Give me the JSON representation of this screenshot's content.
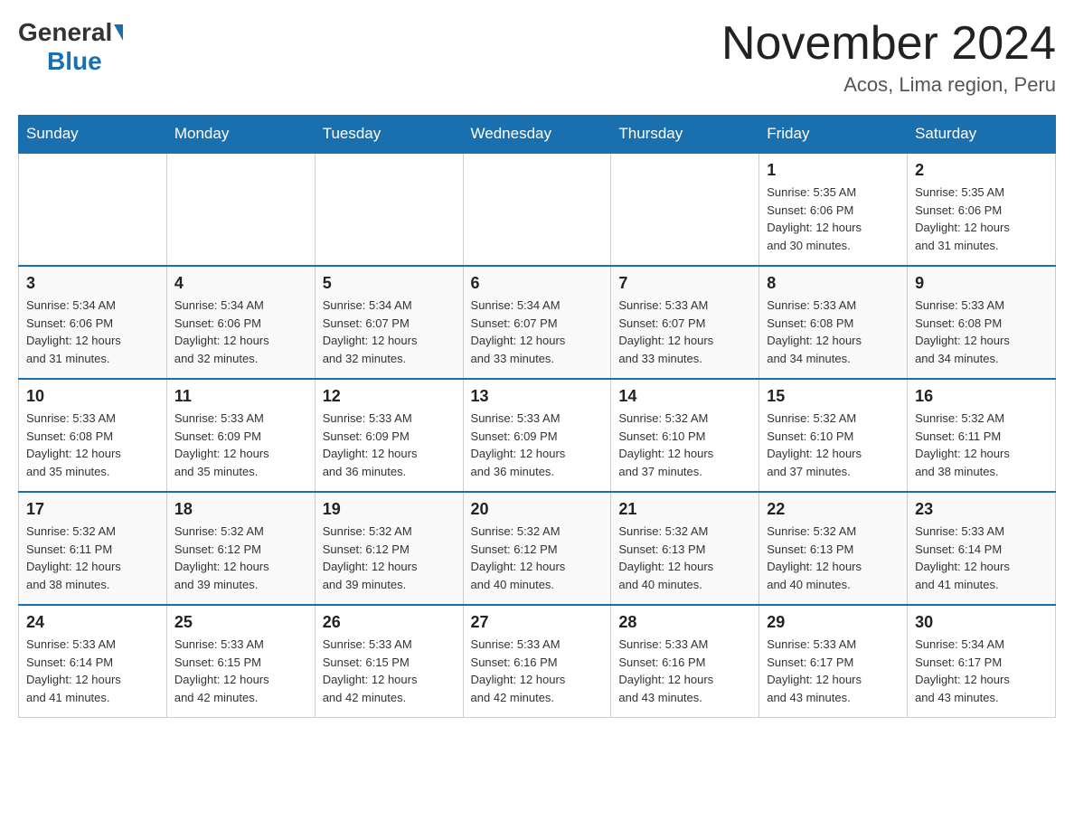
{
  "header": {
    "logo_general": "General",
    "logo_blue": "Blue",
    "month_title": "November 2024",
    "location": "Acos, Lima region, Peru"
  },
  "days_of_week": [
    "Sunday",
    "Monday",
    "Tuesday",
    "Wednesday",
    "Thursday",
    "Friday",
    "Saturday"
  ],
  "weeks": [
    [
      {
        "day": "",
        "info": ""
      },
      {
        "day": "",
        "info": ""
      },
      {
        "day": "",
        "info": ""
      },
      {
        "day": "",
        "info": ""
      },
      {
        "day": "",
        "info": ""
      },
      {
        "day": "1",
        "info": "Sunrise: 5:35 AM\nSunset: 6:06 PM\nDaylight: 12 hours\nand 30 minutes."
      },
      {
        "day": "2",
        "info": "Sunrise: 5:35 AM\nSunset: 6:06 PM\nDaylight: 12 hours\nand 31 minutes."
      }
    ],
    [
      {
        "day": "3",
        "info": "Sunrise: 5:34 AM\nSunset: 6:06 PM\nDaylight: 12 hours\nand 31 minutes."
      },
      {
        "day": "4",
        "info": "Sunrise: 5:34 AM\nSunset: 6:06 PM\nDaylight: 12 hours\nand 32 minutes."
      },
      {
        "day": "5",
        "info": "Sunrise: 5:34 AM\nSunset: 6:07 PM\nDaylight: 12 hours\nand 32 minutes."
      },
      {
        "day": "6",
        "info": "Sunrise: 5:34 AM\nSunset: 6:07 PM\nDaylight: 12 hours\nand 33 minutes."
      },
      {
        "day": "7",
        "info": "Sunrise: 5:33 AM\nSunset: 6:07 PM\nDaylight: 12 hours\nand 33 minutes."
      },
      {
        "day": "8",
        "info": "Sunrise: 5:33 AM\nSunset: 6:08 PM\nDaylight: 12 hours\nand 34 minutes."
      },
      {
        "day": "9",
        "info": "Sunrise: 5:33 AM\nSunset: 6:08 PM\nDaylight: 12 hours\nand 34 minutes."
      }
    ],
    [
      {
        "day": "10",
        "info": "Sunrise: 5:33 AM\nSunset: 6:08 PM\nDaylight: 12 hours\nand 35 minutes."
      },
      {
        "day": "11",
        "info": "Sunrise: 5:33 AM\nSunset: 6:09 PM\nDaylight: 12 hours\nand 35 minutes."
      },
      {
        "day": "12",
        "info": "Sunrise: 5:33 AM\nSunset: 6:09 PM\nDaylight: 12 hours\nand 36 minutes."
      },
      {
        "day": "13",
        "info": "Sunrise: 5:33 AM\nSunset: 6:09 PM\nDaylight: 12 hours\nand 36 minutes."
      },
      {
        "day": "14",
        "info": "Sunrise: 5:32 AM\nSunset: 6:10 PM\nDaylight: 12 hours\nand 37 minutes."
      },
      {
        "day": "15",
        "info": "Sunrise: 5:32 AM\nSunset: 6:10 PM\nDaylight: 12 hours\nand 37 minutes."
      },
      {
        "day": "16",
        "info": "Sunrise: 5:32 AM\nSunset: 6:11 PM\nDaylight: 12 hours\nand 38 minutes."
      }
    ],
    [
      {
        "day": "17",
        "info": "Sunrise: 5:32 AM\nSunset: 6:11 PM\nDaylight: 12 hours\nand 38 minutes."
      },
      {
        "day": "18",
        "info": "Sunrise: 5:32 AM\nSunset: 6:12 PM\nDaylight: 12 hours\nand 39 minutes."
      },
      {
        "day": "19",
        "info": "Sunrise: 5:32 AM\nSunset: 6:12 PM\nDaylight: 12 hours\nand 39 minutes."
      },
      {
        "day": "20",
        "info": "Sunrise: 5:32 AM\nSunset: 6:12 PM\nDaylight: 12 hours\nand 40 minutes."
      },
      {
        "day": "21",
        "info": "Sunrise: 5:32 AM\nSunset: 6:13 PM\nDaylight: 12 hours\nand 40 minutes."
      },
      {
        "day": "22",
        "info": "Sunrise: 5:32 AM\nSunset: 6:13 PM\nDaylight: 12 hours\nand 40 minutes."
      },
      {
        "day": "23",
        "info": "Sunrise: 5:33 AM\nSunset: 6:14 PM\nDaylight: 12 hours\nand 41 minutes."
      }
    ],
    [
      {
        "day": "24",
        "info": "Sunrise: 5:33 AM\nSunset: 6:14 PM\nDaylight: 12 hours\nand 41 minutes."
      },
      {
        "day": "25",
        "info": "Sunrise: 5:33 AM\nSunset: 6:15 PM\nDaylight: 12 hours\nand 42 minutes."
      },
      {
        "day": "26",
        "info": "Sunrise: 5:33 AM\nSunset: 6:15 PM\nDaylight: 12 hours\nand 42 minutes."
      },
      {
        "day": "27",
        "info": "Sunrise: 5:33 AM\nSunset: 6:16 PM\nDaylight: 12 hours\nand 42 minutes."
      },
      {
        "day": "28",
        "info": "Sunrise: 5:33 AM\nSunset: 6:16 PM\nDaylight: 12 hours\nand 43 minutes."
      },
      {
        "day": "29",
        "info": "Sunrise: 5:33 AM\nSunset: 6:17 PM\nDaylight: 12 hours\nand 43 minutes."
      },
      {
        "day": "30",
        "info": "Sunrise: 5:34 AM\nSunset: 6:17 PM\nDaylight: 12 hours\nand 43 minutes."
      }
    ]
  ]
}
